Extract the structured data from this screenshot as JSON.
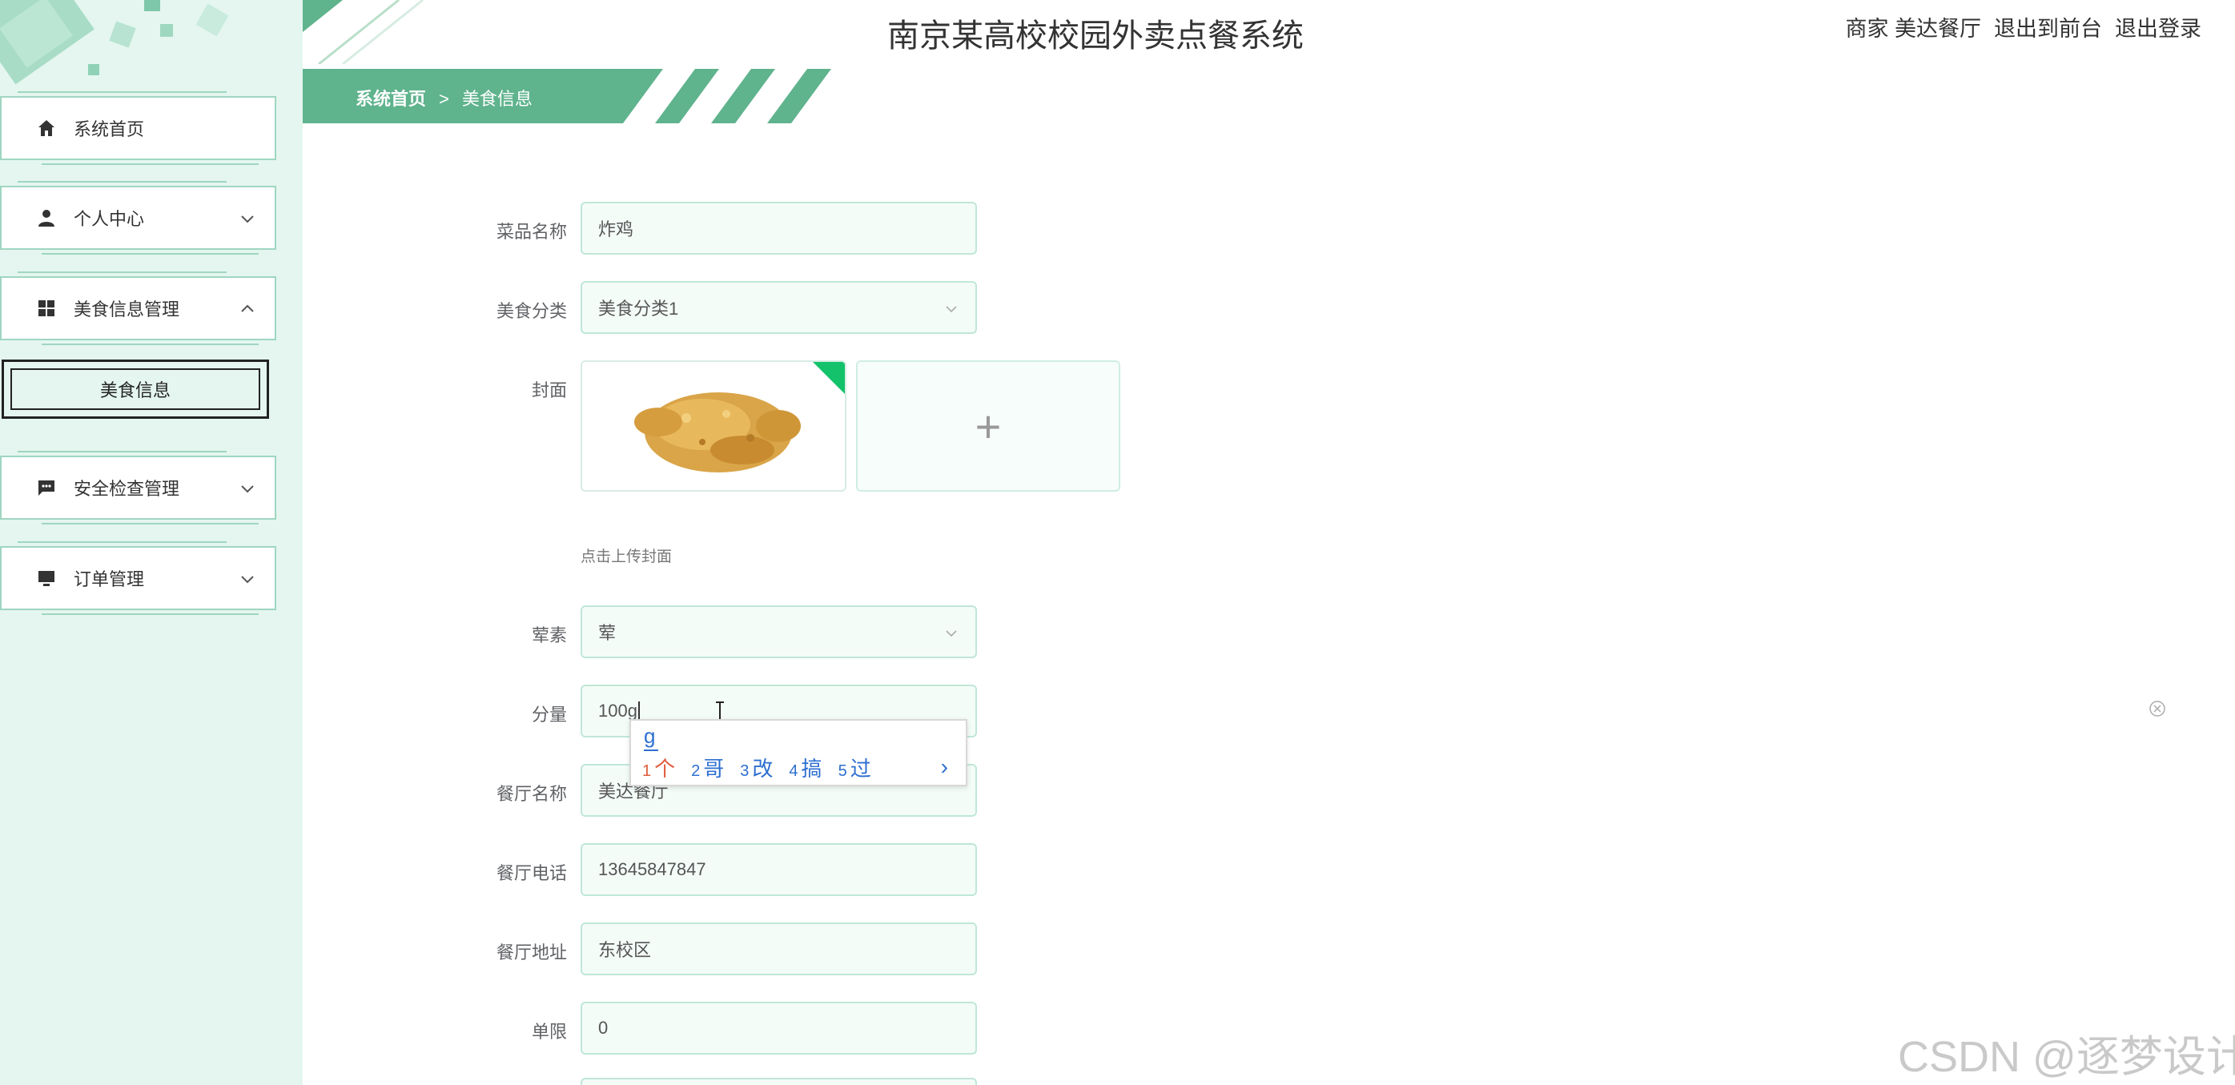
{
  "header": {
    "app_title": "南京某高校校园外卖点餐系统",
    "role_label": "商家",
    "user_name": "美达餐厅",
    "back_to_front_label": "退出到前台",
    "logout_label": "退出登录"
  },
  "breadcrumb": {
    "home": "系统首页",
    "separator": ">",
    "current": "美食信息"
  },
  "sidebar": {
    "items": [
      {
        "label": "系统首页",
        "icon": "home-icon"
      },
      {
        "label": "个人中心",
        "icon": "person-icon"
      },
      {
        "label": "美食信息管理",
        "icon": "grid-icon"
      },
      {
        "label": "安全检查管理",
        "icon": "chat-icon"
      },
      {
        "label": "订单管理",
        "icon": "monitor-icon"
      }
    ],
    "subitem": {
      "label": "美食信息"
    }
  },
  "form": {
    "dish_name": {
      "label": "菜品名称",
      "value": "炸鸡"
    },
    "category": {
      "label": "美食分类",
      "value": "美食分类1"
    },
    "cover": {
      "label": "封面",
      "upload_hint": "点击上传封面",
      "upload_symbol": "+"
    },
    "meat_veg": {
      "label": "荤素",
      "value": "荤"
    },
    "portion": {
      "label": "分量",
      "value": "100g"
    },
    "restaurant_name": {
      "label": "餐厅名称",
      "value": "美达餐厅"
    },
    "restaurant_phone": {
      "label": "餐厅电话",
      "value": "13645847847"
    },
    "restaurant_address": {
      "label": "餐厅地址",
      "value": "东校区"
    },
    "order_limit": {
      "label": "单限",
      "value": "0"
    }
  },
  "ime": {
    "composition": "g",
    "candidates": [
      {
        "num": "1",
        "text": "个"
      },
      {
        "num": "2",
        "text": "哥"
      },
      {
        "num": "3",
        "text": "改"
      },
      {
        "num": "4",
        "text": "搞"
      },
      {
        "num": "5",
        "text": "过"
      }
    ],
    "next": "›"
  },
  "watermark": "CSDN @逐梦设计",
  "colors": {
    "brand_green": "#5fb38d",
    "sidebar_bg": "#e4f6ef",
    "input_border": "#bfe7d7"
  }
}
